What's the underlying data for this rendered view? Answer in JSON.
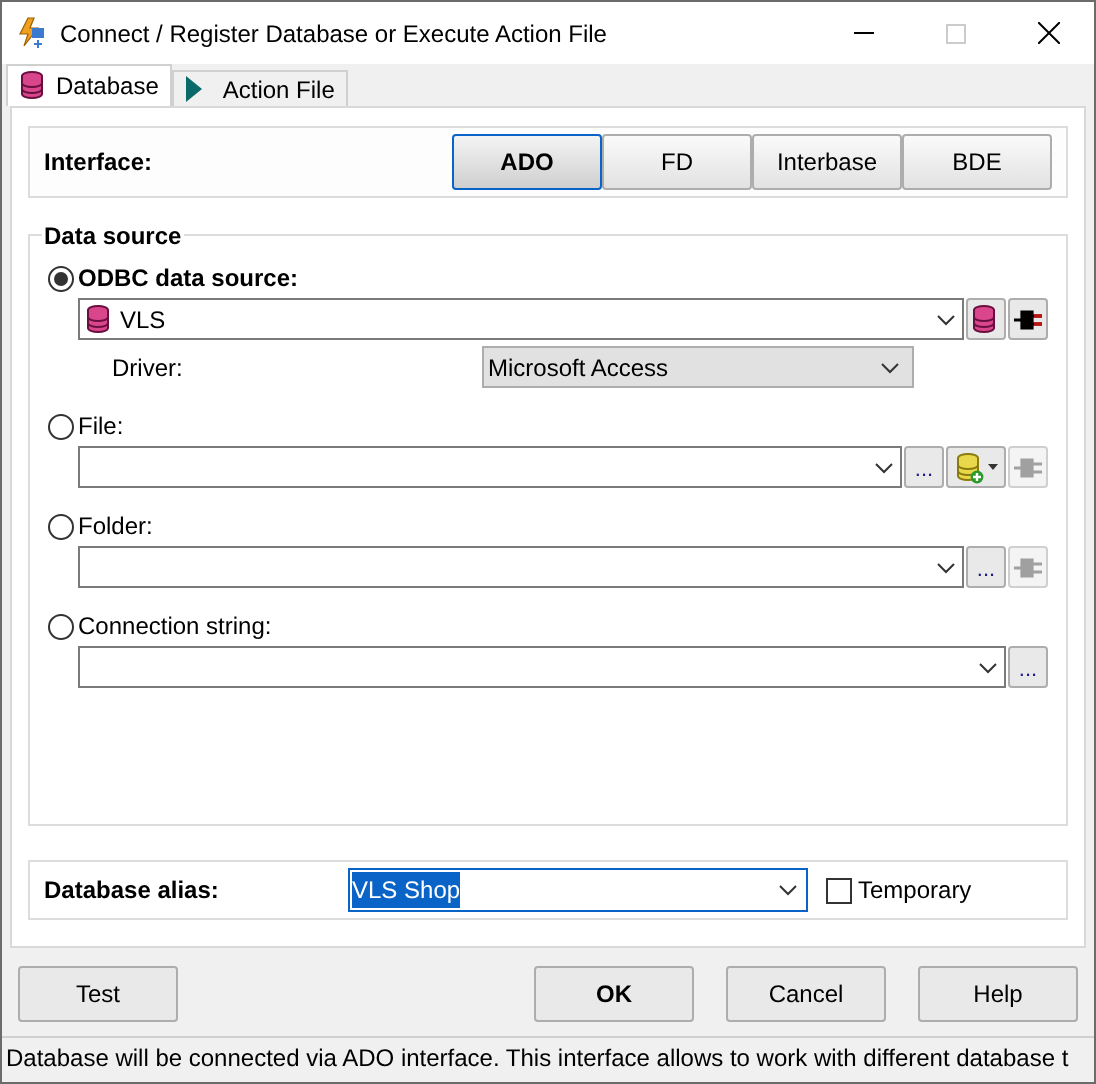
{
  "window": {
    "title": "Connect / Register Database or Execute Action File"
  },
  "tabs": [
    {
      "label": "Database",
      "selected": true,
      "kind": "database"
    },
    {
      "label": "Action File",
      "selected": false,
      "kind": "play"
    }
  ],
  "interface": {
    "label": "Interface:",
    "options": [
      {
        "label": "ADO",
        "selected": true
      },
      {
        "label": "FD",
        "selected": false
      },
      {
        "label": "Interbase",
        "selected": false
      },
      {
        "label": "BDE",
        "selected": false
      }
    ]
  },
  "data_source": {
    "title": "Data source",
    "sources": [
      {
        "kind": "odbc",
        "label": "ODBC data source:",
        "selected": true,
        "value": "VLS",
        "tools": [
          {
            "kind": "database",
            "disabled": false
          },
          {
            "kind": "plug",
            "disabled": false
          }
        ]
      },
      {
        "kind": "file",
        "label": "File:",
        "selected": false,
        "tools": [
          {
            "kind": "ellipsis",
            "label": "...",
            "disabled": false
          },
          {
            "kind": "database-add",
            "disabled": false
          },
          {
            "kind": "plug",
            "disabled": true
          }
        ]
      },
      {
        "kind": "folder",
        "label": "Folder:",
        "selected": false,
        "tools": [
          {
            "kind": "ellipsis",
            "label": "...",
            "disabled": false
          },
          {
            "kind": "plug",
            "disabled": true
          }
        ]
      },
      {
        "kind": "connection",
        "label": "Connection string:",
        "selected": false,
        "tools": [
          {
            "kind": "ellipsis",
            "label": "...",
            "disabled": false
          }
        ]
      }
    ],
    "driver": {
      "label": "Driver:",
      "value": "Microsoft Access"
    }
  },
  "alias": {
    "label": "Database alias:",
    "value": "VLS Shop",
    "temporary": {
      "label": "Temporary",
      "checked": false
    }
  },
  "buttons": [
    {
      "label": "Test",
      "default": false
    },
    {
      "label": "OK",
      "default": true
    },
    {
      "label": "Cancel",
      "default": false
    },
    {
      "label": "Help",
      "default": false
    }
  ],
  "status_bar": "Database will be connected via ADO interface. This interface allows to work with different database t"
}
